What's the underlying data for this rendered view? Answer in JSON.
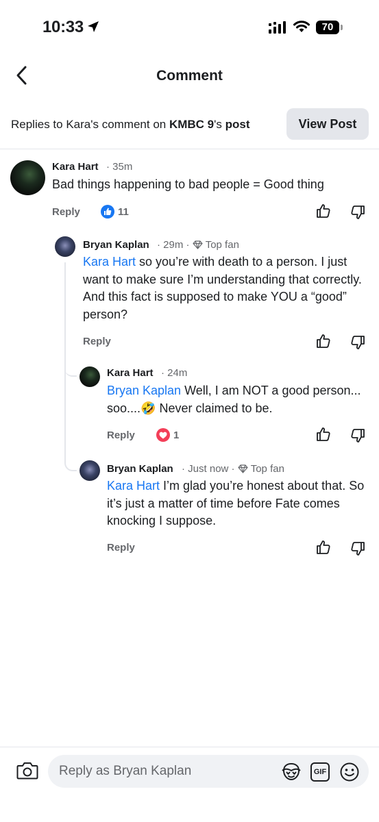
{
  "status": {
    "time": "10:33",
    "battery": "70"
  },
  "nav": {
    "title": "Comment",
    "back_icon": "chevron-left-icon"
  },
  "context": {
    "prefix": "Replies to Kara's comment on ",
    "page": "KMBC 9",
    "suffix_a": "'s ",
    "suffix_b": "post",
    "view_post": "View Post"
  },
  "comments": [
    {
      "author": "Kara Hart",
      "time": "35m",
      "text": "Bad things happening to bad people = Good thing",
      "reply_label": "Reply",
      "reaction": "like",
      "reaction_count": "11"
    },
    {
      "author": "Bryan Kaplan",
      "time": "29m",
      "badge": "Top fan",
      "mention": "Kara Hart",
      "text": " so you’re with death to a person. I just want to make sure I’m understanding that correctly.  And this fact is supposed to make YOU a “good” person?",
      "reply_label": "Reply"
    },
    {
      "author": "Kara Hart",
      "time": "24m",
      "mention": "Bryan Kaplan",
      "text": " Well, I am NOT a good person... soo....🤣 Never claimed to be.",
      "reply_label": "Reply",
      "reaction": "love",
      "reaction_count": "1"
    },
    {
      "author": "Bryan Kaplan",
      "time": "Just now",
      "badge": "Top fan",
      "mention": "Kara Hart",
      "text": " I’m glad you’re honest about that. So it’s just a matter of time before Fate comes knocking I suppose.",
      "reply_label": "Reply"
    }
  ],
  "composer": {
    "placeholder": "Reply as Bryan Kaplan",
    "gif_label": "GIF"
  },
  "colors": {
    "link": "#1877f2",
    "secondary_text": "#65676b",
    "divider": "#e4e6eb",
    "love": "#f33e58"
  }
}
